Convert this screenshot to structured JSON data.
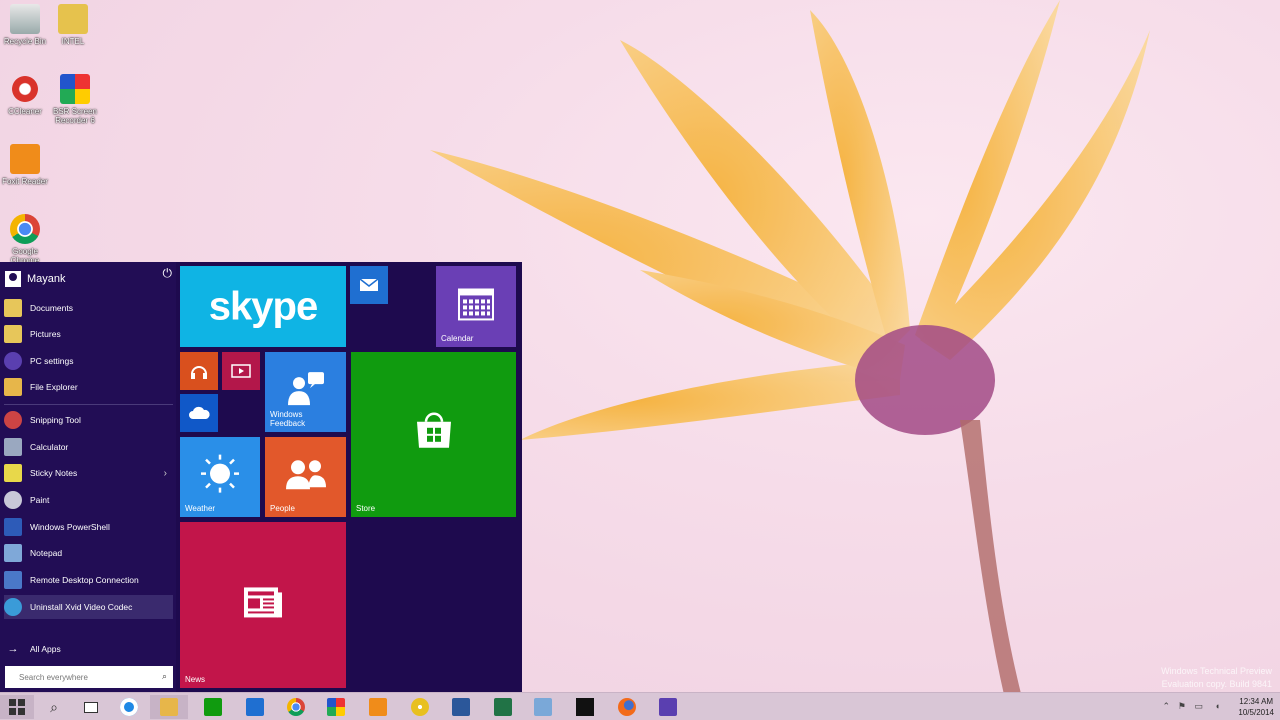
{
  "desktop": {
    "icons": [
      {
        "label": "Recycle Bin",
        "icon": "recycle-bin-icon"
      },
      {
        "label": "INTEL",
        "icon": "folder-icon"
      },
      {
        "label": "CCleaner",
        "icon": "ccleaner-icon"
      },
      {
        "label": "BSR Screen Recorder 6",
        "icon": "bsr-recorder-icon"
      },
      {
        "label": "Foxit Reader",
        "icon": "foxit-reader-icon"
      },
      {
        "label": "Google Chrome",
        "icon": "chrome-icon"
      }
    ],
    "watermark_line1": "Windows Technical Preview",
    "watermark_line2": "Evaluation copy. Build 9841"
  },
  "start_menu": {
    "user_name": "Mayank",
    "items": [
      {
        "label": "Documents",
        "icon": "documents-icon"
      },
      {
        "label": "Pictures",
        "icon": "pictures-icon"
      },
      {
        "label": "PC settings",
        "icon": "gear-icon"
      },
      {
        "label": "File Explorer",
        "icon": "file-explorer-icon"
      },
      {
        "label": "Snipping Tool",
        "icon": "snipping-tool-icon"
      },
      {
        "label": "Calculator",
        "icon": "calculator-icon"
      },
      {
        "label": "Sticky Notes",
        "icon": "sticky-notes-icon"
      },
      {
        "label": "Paint",
        "icon": "paint-icon"
      },
      {
        "label": "Windows PowerShell",
        "icon": "powershell-icon"
      },
      {
        "label": "Notepad",
        "icon": "notepad-icon"
      },
      {
        "label": "Remote Desktop Connection",
        "icon": "remote-desktop-icon"
      },
      {
        "label": "Uninstall Xvid Video Codec",
        "icon": "xvid-icon"
      }
    ],
    "all_apps": "All Apps",
    "search_placeholder": "Search everywhere",
    "tiles": {
      "skype": "skype",
      "calendar": "Calendar",
      "windows_feedback": "Windows Feedback",
      "weather": "Weather",
      "people": "People",
      "store": "Store",
      "news": "News"
    }
  },
  "taskbar": {
    "time": "12:34 AM",
    "date": "10/5/2014"
  },
  "colors": {
    "start_bg": "#1e0a4e",
    "skype": "#0fb4e4",
    "calendar": "#6a3fb5",
    "feedback": "#2b7fe0",
    "weather": "#2a8fe8",
    "people": "#e2582b",
    "store": "#109b0f",
    "news": "#c2154a",
    "music": "#d9501e",
    "video": "#b3174a",
    "onedrive": "#1058c8",
    "mail": "#1f6fd1"
  }
}
